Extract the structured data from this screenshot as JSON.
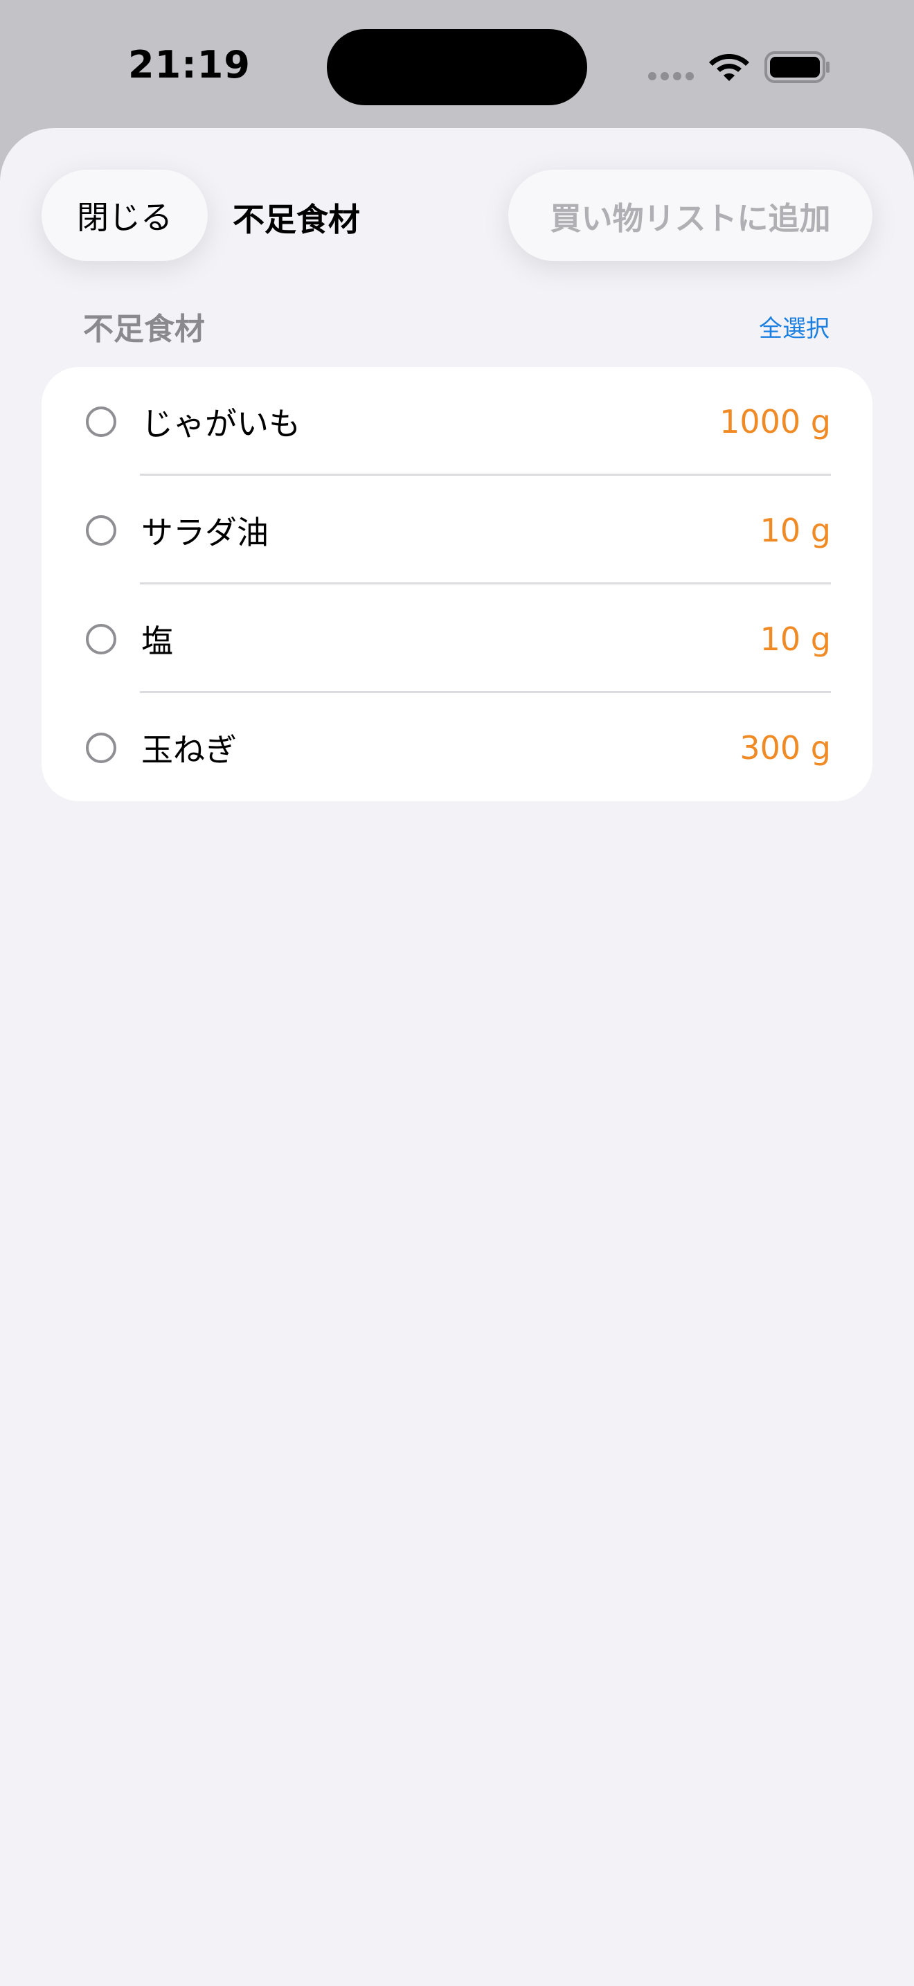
{
  "status_bar": {
    "time": "21:19"
  },
  "sheet": {
    "close_label": "閉じる",
    "title": "不足食材",
    "add_label": "買い物リストに追加"
  },
  "section": {
    "header": "不足食材",
    "select_all": "全選択"
  },
  "items": [
    {
      "name": "じゃがいも",
      "qty": "1000 g"
    },
    {
      "name": "サラダ油",
      "qty": "10 g"
    },
    {
      "name": "塩",
      "qty": "10 g"
    },
    {
      "name": "玉ねぎ",
      "qty": "300 g"
    }
  ],
  "colors": {
    "accent_orange": "#f08a24",
    "link_blue": "#1a7fe0",
    "disabled_gray": "#b0b0b4"
  },
  "icons": [
    "wifi-icon",
    "battery-icon",
    "signal-icon",
    "checkbox-circle-icon"
  ]
}
